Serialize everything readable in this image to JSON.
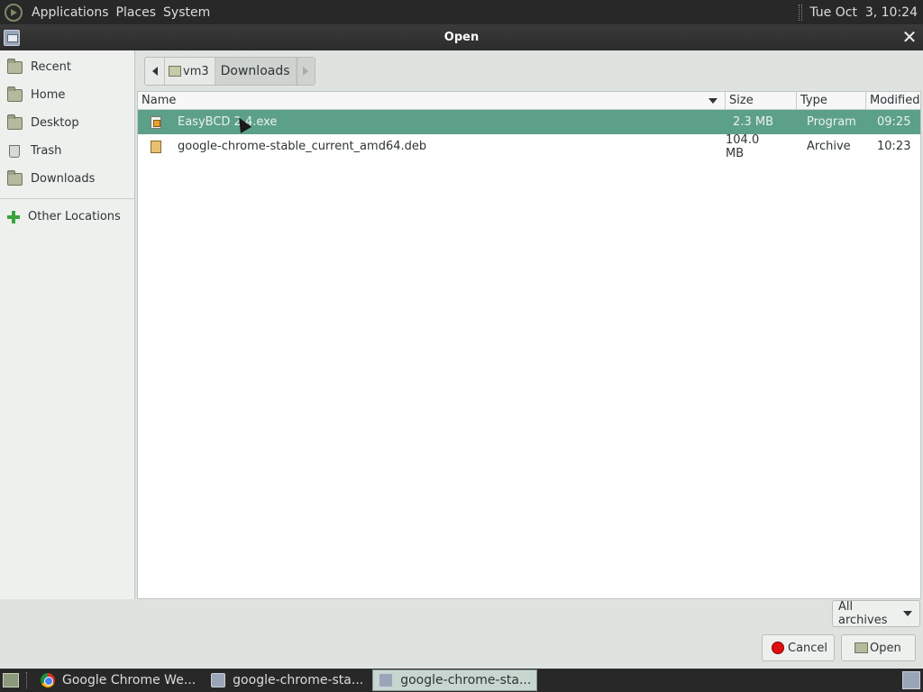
{
  "top_panel": {
    "menus": [
      "Applications",
      "Places",
      "System"
    ],
    "clock": "Tue Oct  3, 10:24"
  },
  "window": {
    "title": "Open"
  },
  "sidebar": {
    "items": [
      {
        "label": "Recent",
        "icon": "recent-folder-icon"
      },
      {
        "label": "Home",
        "icon": "home-folder-icon"
      },
      {
        "label": "Desktop",
        "icon": "desktop-folder-icon"
      },
      {
        "label": "Trash",
        "icon": "trash-icon"
      },
      {
        "label": "Downloads",
        "icon": "downloads-folder-icon"
      }
    ],
    "other_locations": {
      "label": "Other Locations",
      "icon": "plus-icon"
    }
  },
  "pathbar": {
    "home": "vm3",
    "current": "Downloads"
  },
  "filelist": {
    "columns": {
      "name": "Name",
      "size": "Size",
      "type": "Type",
      "modified": "Modified"
    },
    "rows": [
      {
        "name": "EasyBCD 2.4.exe",
        "size": "2.3 MB",
        "type": "Program",
        "modified": "09:25",
        "selected": true
      },
      {
        "name": "google-chrome-stable_current_amd64.deb",
        "size": "104.0 MB",
        "type": "Archive",
        "modified": "10:23",
        "selected": false
      }
    ]
  },
  "filter": {
    "selected": "All archives"
  },
  "buttons": {
    "cancel": "Cancel",
    "open": "Open"
  },
  "taskbar": {
    "tasks": [
      {
        "label": "Google Chrome We...",
        "icon": "chrome-icon",
        "active": false
      },
      {
        "label": "google-chrome-sta...",
        "icon": "dialog-icon",
        "active": false
      },
      {
        "label": "google-chrome-sta...",
        "icon": "dialog-icon",
        "active": true
      }
    ]
  },
  "colors": {
    "selection": "#5da08a",
    "panel": "#282828",
    "dialog_bg": "#dfe3e0"
  }
}
